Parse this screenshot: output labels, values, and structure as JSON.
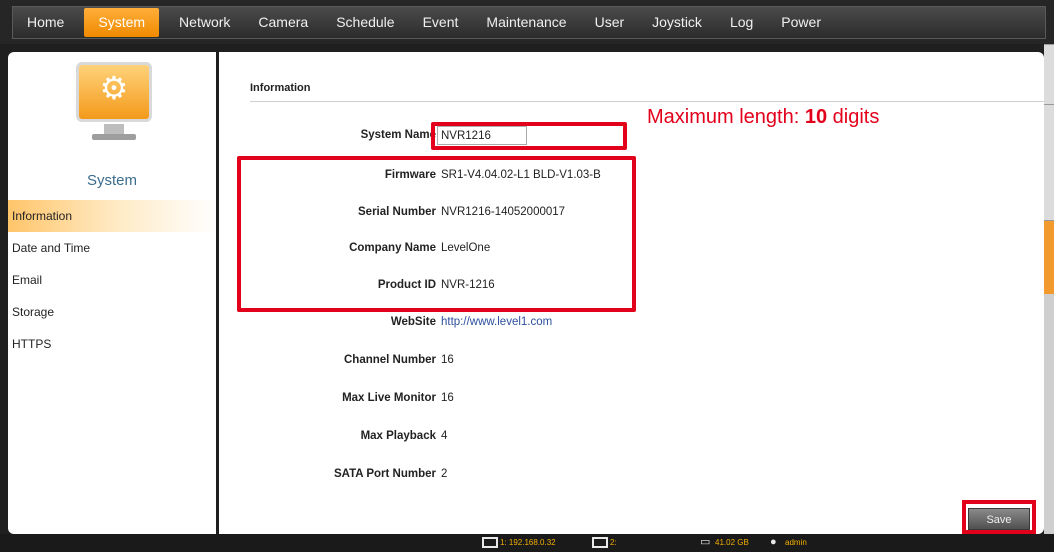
{
  "nav": {
    "items": [
      "Home",
      "System",
      "Network",
      "Camera",
      "Schedule",
      "Event",
      "Maintenance",
      "User",
      "Joystick",
      "Log",
      "Power"
    ],
    "active": "System",
    "accent_color": "#f39a1a"
  },
  "sidebar": {
    "title": "System",
    "icon": "monitor-gear-icon",
    "items": [
      "Information",
      "Date and Time",
      "Email",
      "Storage",
      "HTTPS"
    ],
    "active": "Information"
  },
  "main": {
    "heading": "Information",
    "fields": {
      "system_name": {
        "label": "System Name",
        "value": "NVR1216"
      },
      "firmware": {
        "label": "Firmware",
        "value": "SR1-V4.04.02-L1 BLD-V1.03-B"
      },
      "serial": {
        "label": "Serial Number",
        "value": "NVR1216-14052000017"
      },
      "company": {
        "label": "Company Name",
        "value": "LevelOne"
      },
      "product": {
        "label": "Product ID",
        "value": "NVR-1216"
      },
      "website": {
        "label": "WebSite",
        "value": "http://www.level1.com"
      },
      "channels": {
        "label": "Channel Number",
        "value": "16"
      },
      "live": {
        "label": "Max Live Monitor",
        "value": "16"
      },
      "playback": {
        "label": "Max Playback",
        "value": "4"
      },
      "sata": {
        "label": "SATA Port Number",
        "value": "2"
      }
    },
    "save_label": "Save"
  },
  "annotation": {
    "prefix": "Maximum length: ",
    "number": "10",
    "suffix": " digits",
    "color": "#e3001b"
  },
  "statusbar": {
    "ch1": "1: 192.168.0.32",
    "ch2": "2:",
    "disk": "41.02 GB",
    "user": "admin"
  }
}
